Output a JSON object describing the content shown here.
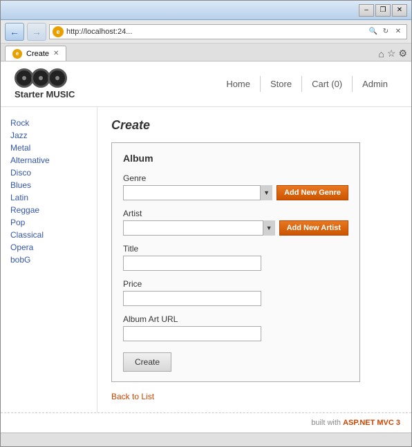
{
  "window": {
    "title": "Create",
    "title_buttons": {
      "minimize": "–",
      "restore": "❐",
      "close": "✕"
    }
  },
  "addressbar": {
    "url": "http://localhost:24...",
    "ie_label": "e",
    "icons": [
      "🔍",
      "↻",
      "✕"
    ]
  },
  "tab": {
    "label": "Create",
    "ie_label": "e",
    "close": "✕"
  },
  "tabbar_icons": {
    "home": "⌂",
    "star": "☆",
    "gear": "⚙"
  },
  "header": {
    "logo_text": "Starter MUSIC",
    "nav": [
      {
        "label": "Home"
      },
      {
        "label": "Store"
      },
      {
        "label": "Cart (0)"
      },
      {
        "label": "Admin"
      }
    ]
  },
  "sidebar": {
    "items": [
      {
        "label": "Rock"
      },
      {
        "label": "Jazz"
      },
      {
        "label": "Metal"
      },
      {
        "label": "Alternative"
      },
      {
        "label": "Disco"
      },
      {
        "label": "Blues"
      },
      {
        "label": "Latin"
      },
      {
        "label": "Reggae"
      },
      {
        "label": "Pop"
      },
      {
        "label": "Classical"
      },
      {
        "label": "Opera"
      },
      {
        "label": "bobG"
      }
    ]
  },
  "page": {
    "title": "Create",
    "panel_title": "Album",
    "fields": {
      "genre_label": "Genre",
      "genre_add_btn": "Add New Genre",
      "artist_label": "Artist",
      "artist_add_btn": "Add New Artist",
      "title_label": "Title",
      "price_label": "Price",
      "album_art_label": "Album Art URL"
    },
    "create_btn": "Create",
    "back_link": "Back to List"
  },
  "footer": {
    "text": "built with ",
    "highlight": "ASP.NET MVC 3"
  }
}
